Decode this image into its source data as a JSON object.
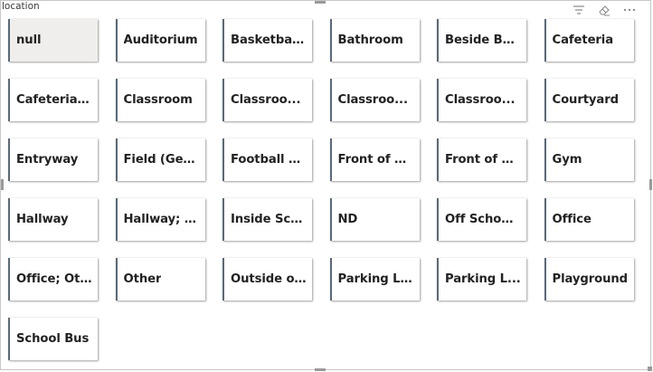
{
  "visual": {
    "title": "location"
  },
  "header": {
    "icons": [
      "filter-lines-icon",
      "eraser-icon",
      "more-options-icon"
    ]
  },
  "tiles": [
    {
      "label": "null",
      "selected": true
    },
    {
      "label": "Auditorium",
      "selected": false
    },
    {
      "label": "Basketball...",
      "selected": false
    },
    {
      "label": "Bathroom",
      "selected": false
    },
    {
      "label": "Beside Bui...",
      "selected": false
    },
    {
      "label": "Cafeteria",
      "selected": false
    },
    {
      "label": "Cafeteria; ...",
      "selected": false
    },
    {
      "label": "Classroom",
      "selected": false
    },
    {
      "label": "Classroo...",
      "selected": false
    },
    {
      "label": "Classroo...",
      "selected": false
    },
    {
      "label": "Classroo...",
      "selected": false
    },
    {
      "label": "Courtyard",
      "selected": false
    },
    {
      "label": "Entryway",
      "selected": false
    },
    {
      "label": "Field (Gen...",
      "selected": false
    },
    {
      "label": "Football Fi...",
      "selected": false
    },
    {
      "label": "Front of S...",
      "selected": false
    },
    {
      "label": "Front of S...",
      "selected": false
    },
    {
      "label": "Gym",
      "selected": false
    },
    {
      "label": "Hallway",
      "selected": false
    },
    {
      "label": "Hallway; B...",
      "selected": false
    },
    {
      "label": "Inside Sch...",
      "selected": false
    },
    {
      "label": "ND",
      "selected": false
    },
    {
      "label": "Off School ...",
      "selected": false
    },
    {
      "label": "Office",
      "selected": false
    },
    {
      "label": "Office; Oth...",
      "selected": false
    },
    {
      "label": "Other",
      "selected": false
    },
    {
      "label": "Outside on...",
      "selected": false
    },
    {
      "label": "Parking Lot",
      "selected": false
    },
    {
      "label": "Parking L...",
      "selected": false
    },
    {
      "label": "Playground",
      "selected": false
    },
    {
      "label": "School Bus",
      "selected": false
    }
  ],
  "colors": {
    "tile_accent": "#5a6a7a",
    "selected_bg": "#f0eeec",
    "text": "#222222"
  }
}
